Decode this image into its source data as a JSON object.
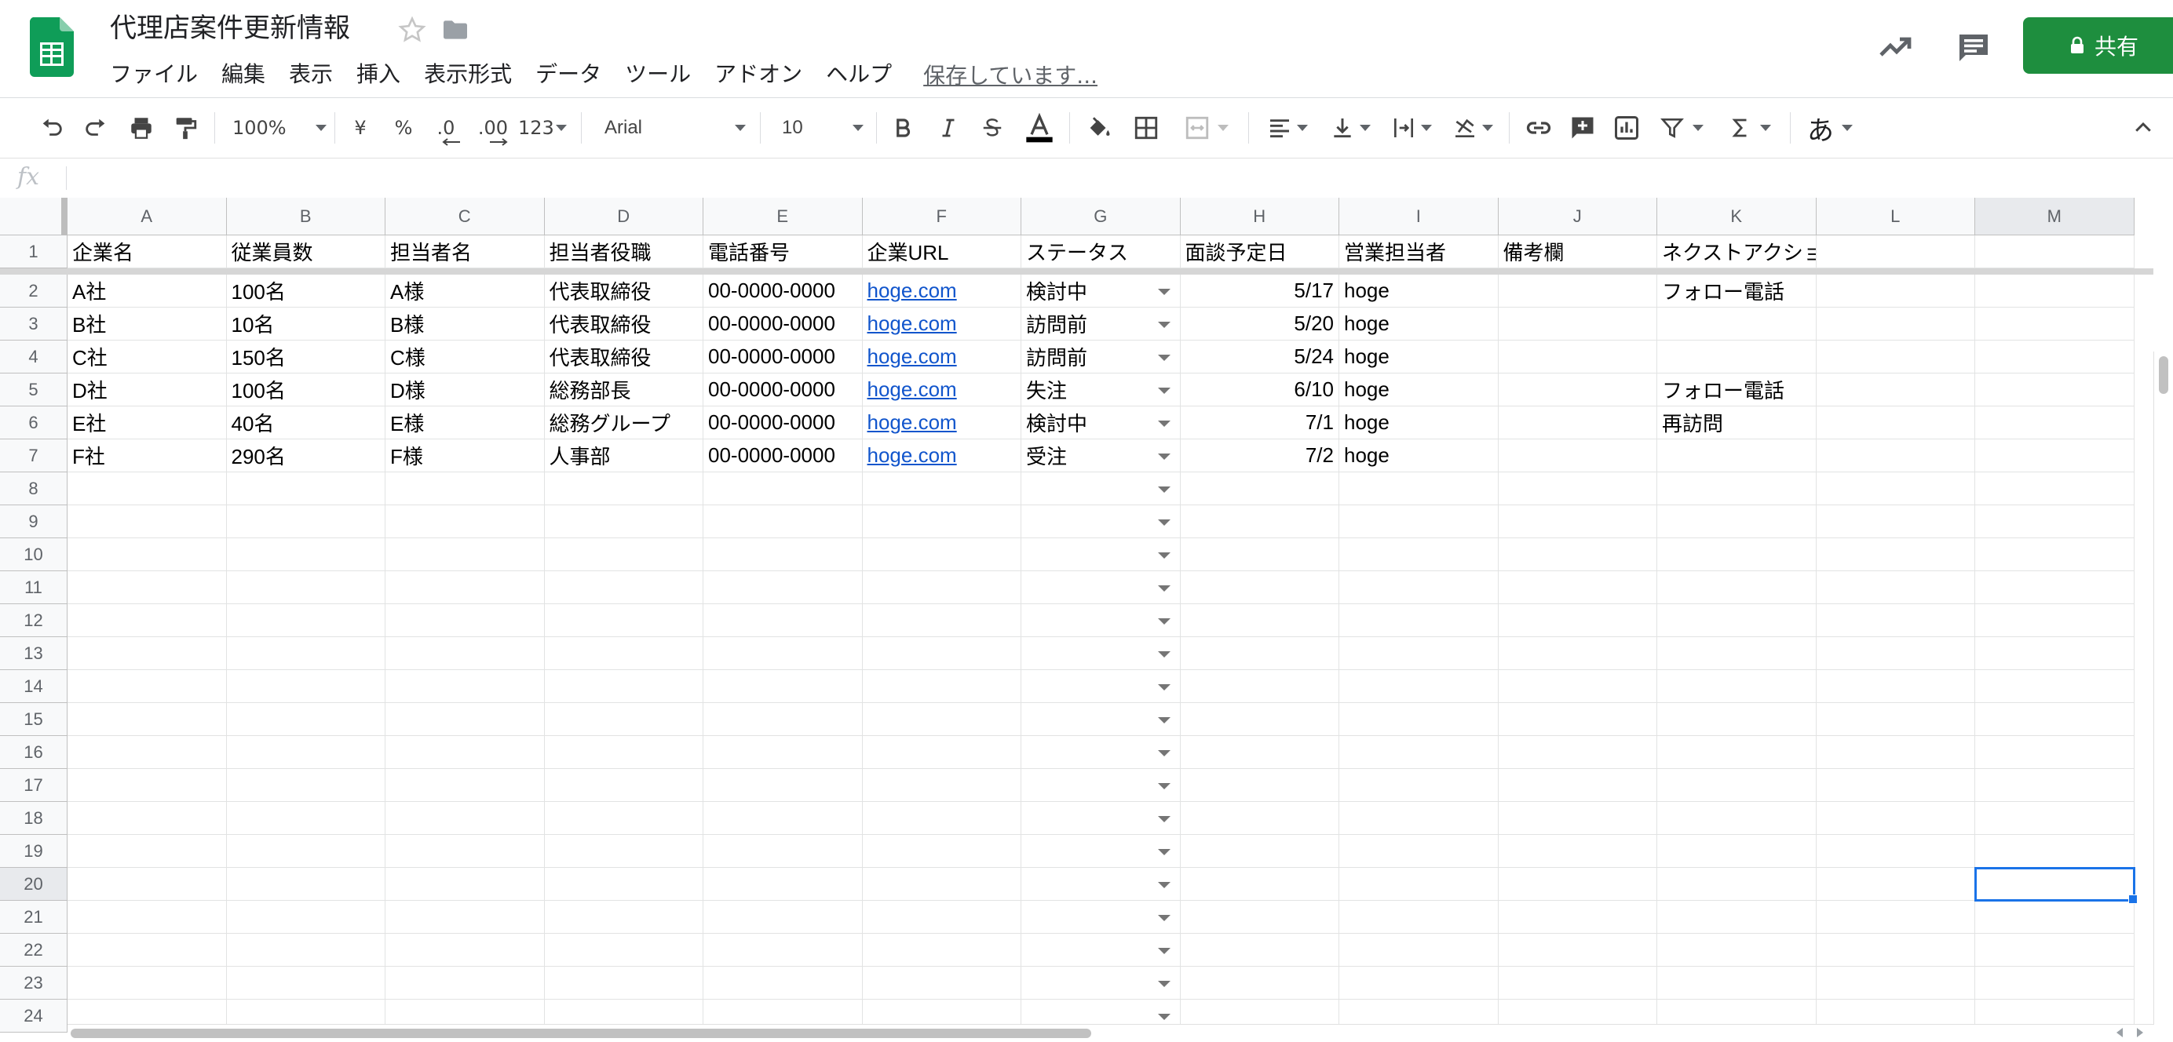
{
  "doc": {
    "title": "代理店案件更新情報",
    "save_status": "保存しています..."
  },
  "menu": [
    "ファイル",
    "編集",
    "表示",
    "挿入",
    "表示形式",
    "データ",
    "ツール",
    "アドオン",
    "ヘルプ"
  ],
  "share": {
    "label": "共有"
  },
  "toolbar": {
    "zoom": "100%",
    "currency": "¥",
    "percent": "%",
    "decimal_decrease": ".0",
    "decimal_increase": ".00",
    "number_format": "123",
    "font": "Arial",
    "font_size": "10",
    "input_tool": "あ"
  },
  "formula_bar": {
    "fx_label": "fx"
  },
  "columns": [
    "A",
    "B",
    "C",
    "D",
    "E",
    "F",
    "G",
    "H",
    "I",
    "J",
    "K",
    "L",
    "M"
  ],
  "rows": [
    "1",
    "2",
    "3",
    "4",
    "5",
    "6",
    "7",
    "8",
    "9",
    "10",
    "11",
    "12",
    "13",
    "14",
    "15",
    "16",
    "17",
    "18",
    "19",
    "20",
    "21",
    "22",
    "23",
    "24"
  ],
  "sheet": {
    "header": [
      "企業名",
      "従業員数",
      "担当者名",
      "担当者役職",
      "電話番号",
      "企業URL",
      "ステータス",
      "面談予定日",
      "営業担当者",
      "備考欄",
      "ネクストアクション",
      "",
      ""
    ],
    "data": [
      [
        "A社",
        "100名",
        "A様",
        "代表取締役",
        "00-0000-0000",
        "hoge.com",
        "検討中",
        "5/17",
        "hoge",
        "",
        "フォロー電話",
        "",
        ""
      ],
      [
        "B社",
        "10名",
        "B様",
        "代表取締役",
        "00-0000-0000",
        "hoge.com",
        "訪問前",
        "5/20",
        "hoge",
        "",
        "",
        "",
        ""
      ],
      [
        "C社",
        "150名",
        "C様",
        "代表取締役",
        "00-0000-0000",
        "hoge.com",
        "訪問前",
        "5/24",
        "hoge",
        "",
        "",
        "",
        ""
      ],
      [
        "D社",
        "100名",
        "D様",
        "総務部長",
        "00-0000-0000",
        "hoge.com",
        "失注",
        "6/10",
        "hoge",
        "",
        "フォロー電話",
        "",
        ""
      ],
      [
        "E社",
        "40名",
        "E様",
        "総務グループ",
        "00-0000-0000",
        "hoge.com",
        "検討中",
        "7/1",
        "hoge",
        "",
        "再訪問",
        "",
        ""
      ],
      [
        "F社",
        "290名",
        "F様",
        "人事部",
        "00-0000-0000",
        "hoge.com",
        "受注",
        "7/2",
        "hoge",
        "",
        "",
        "",
        ""
      ]
    ],
    "active_column": "M",
    "active_row": "20"
  },
  "colors": {
    "sheets_green": "#0f9d58",
    "share_green": "#1e8e3e",
    "link_blue": "#1155cc",
    "selection_blue": "#1a73e8"
  }
}
